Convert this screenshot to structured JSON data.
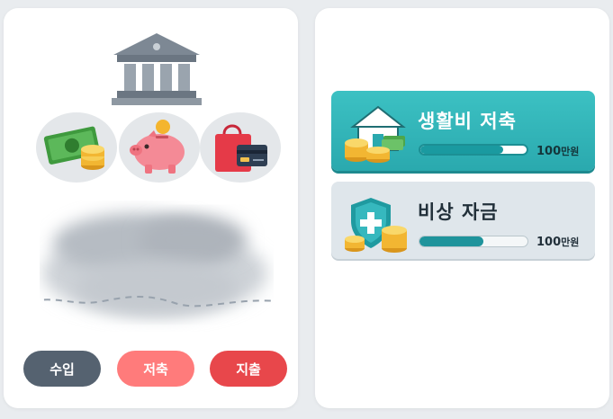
{
  "left_panel": {
    "buttons": {
      "income_label": "수입",
      "save_label": "저축",
      "spend_label": "지출"
    }
  },
  "right_panel": {
    "goals": [
      {
        "title": "생활비 저축",
        "amount_number": "100",
        "amount_unit": "만원",
        "progress": 0.78,
        "icon": "house-coins-icon"
      },
      {
        "title": "비상 자금",
        "amount_number": "100",
        "amount_unit": "만원",
        "progress": 0.59,
        "icon": "shield-coins-icon"
      }
    ]
  },
  "colors": {
    "income_button": "#556270",
    "save_button": "#ff7b7b",
    "spend_button": "#e8474b",
    "accent_teal": "#2aa9ae"
  }
}
